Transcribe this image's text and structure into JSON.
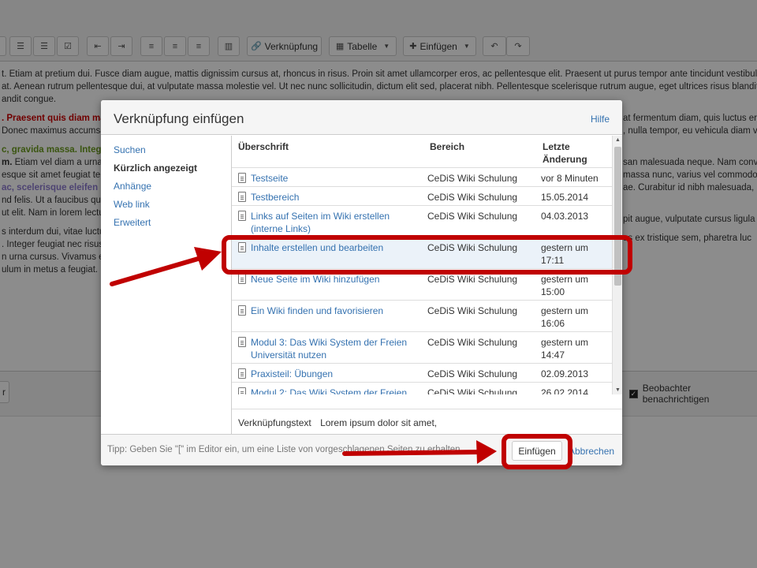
{
  "toolbar": {
    "link_label": "Verknüpfung",
    "table_label": "Tabelle",
    "insert_label": "Einfügen"
  },
  "editor": {
    "lines": [
      "t. Etiam at pretium dui. Fusce diam augue, mattis dignissim cursus at, rhoncus in risus. Proin sit amet ullamcorper eros, ac pellentesque elit. Praesent ut purus tempor ante tincidunt vestibulum nec",
      "at. Aenean rutrum pellentesque dui, at vulputate massa molestie vel. Ut nec nunc sollicitudin, dictum elit sed, placerat nibh. Pellentesque scelerisque rutrum augue, eget ultrices risus blandit et. A",
      "andit congue."
    ],
    "left_fragments": [
      {
        "text": ". Praesent quis diam ma",
        "style": "red"
      },
      {
        "text": "Donec maximus accumsan",
        "style": "plain"
      },
      {
        "text": "c, gravida massa. Integ",
        "style": "green"
      },
      {
        "text": "m. Etiam vel diam a urna c",
        "style": "boldstart"
      },
      {
        "text": "esque sit amet feugiat tell",
        "style": "plain"
      },
      {
        "text": "ac, scelerisque eleifen",
        "style": "purple"
      },
      {
        "text": "nd felis. Ut a faucibus qua",
        "style": "plain"
      },
      {
        "text": "ut elit. Nam in lorem lectu",
        "style": "plain"
      },
      {
        "text": "s interdum dui, vitae luctus",
        "style": "plain"
      },
      {
        "text": ". Integer feugiat nec risus",
        "style": "plain"
      },
      {
        "text": "n urna cursus. Vivamus e",
        "style": "plain"
      },
      {
        "text": "ulum in metus a feugiat.",
        "style": "plain"
      }
    ],
    "right_fragments": [
      "at fermentum diam, quis luctus era",
      ", nulla tempor, eu vehicula diam ve",
      "san malesuada neque. Nam conva",
      "massa nunc, varius vel commodo vi",
      "ae. Curabitur id nibh malesuada, m",
      "pit augue, vulputate cursus ligula I",
      "us ex tristique sem, pharetra luc"
    ],
    "save_left_label": "r",
    "watch_label": "Beobachter benachrichtigen"
  },
  "dialog": {
    "title": "Verknüpfung einfügen",
    "help": "Hilfe",
    "nav": [
      {
        "label": "Suchen",
        "active": false
      },
      {
        "label": "Kürzlich angezeigt",
        "active": true
      },
      {
        "label": "Anhänge",
        "active": false
      },
      {
        "label": "Web link",
        "active": false
      },
      {
        "label": "Erweitert",
        "active": false
      }
    ],
    "columns": {
      "title": "Überschrift",
      "space": "Bereich",
      "date": "Letzte Änderung"
    },
    "rows": [
      {
        "title": "Testseite",
        "space": "CeDiS Wiki Schulung",
        "date": "vor 8 Minuten",
        "selected": false
      },
      {
        "title": "Testbereich",
        "space": "CeDiS Wiki Schulung",
        "date": "15.05.2014",
        "selected": false
      },
      {
        "title": "Links auf Seiten im Wiki erstellen (interne Links)",
        "space": "CeDiS Wiki Schulung",
        "date": "04.03.2013",
        "selected": false
      },
      {
        "title": "Inhalte erstellen und bearbeiten",
        "space": "CeDiS Wiki Schulung",
        "date": "gestern um 17:11",
        "selected": true
      },
      {
        "title": "Neue Seite im Wiki hinzufügen",
        "space": "CeDiS Wiki Schulung",
        "date": "gestern um 15:00",
        "selected": false
      },
      {
        "title": "Ein Wiki finden und favorisieren",
        "space": "CeDiS Wiki Schulung",
        "date": "gestern um 16:06",
        "selected": false
      },
      {
        "title": "Modul 3: Das Wiki System der Freien Universität nutzen",
        "space": "CeDiS Wiki Schulung",
        "date": "gestern um 14:47",
        "selected": false
      },
      {
        "title": "Praxisteil: Übungen",
        "space": "CeDiS Wiki Schulung",
        "date": "02.09.2013",
        "selected": false
      },
      {
        "title": "Modul 2: Das Wiki System der Freien",
        "space": "CeDiS Wiki Schulung",
        "date": "26.02.2014",
        "selected": false
      }
    ],
    "link_text_label": "Verknüpfungstext",
    "link_text_value": "Lorem ipsum dolor sit amet,",
    "tip": "Tipp: Geben Sie \"[\" im Editor ein, um eine Liste von vorgeschlagenen Seiten zu erhalten.",
    "insert_button": "Einfügen",
    "cancel": "Abbrechen"
  },
  "annotation_color": "#c00000"
}
